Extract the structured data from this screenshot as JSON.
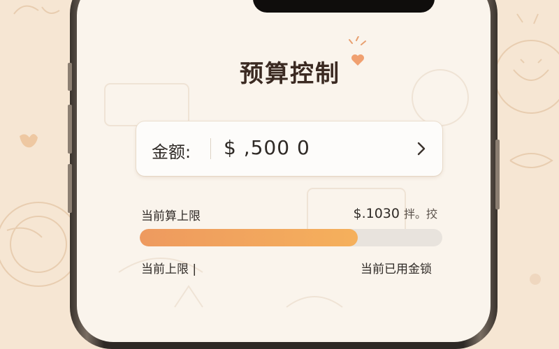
{
  "screen": {
    "title": "预算控制"
  },
  "amount": {
    "label": "金额:",
    "value": "$ ,500 0"
  },
  "budget": {
    "limit_label": "当前算上限",
    "limit_value": "$.1030",
    "limit_suffix": "拌。挍",
    "progress_fraction": 0.72,
    "footer_left": "当前上限 |",
    "footer_right": "当前已用金锁"
  },
  "colors": {
    "accent": "#f0a060",
    "background": "#f6e6d3",
    "text": "#2f2a26"
  }
}
